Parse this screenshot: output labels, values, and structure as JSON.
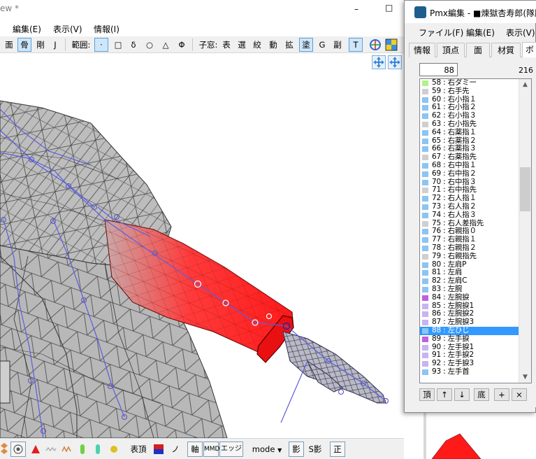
{
  "main_window": {
    "title": "ew *",
    "controls": {
      "minimize": "–",
      "maximize": "□",
      "close": "✕"
    },
    "menu": [
      "編集(E)",
      "表示(V)",
      "情報(I)"
    ],
    "toolbar": {
      "mode_buttons": [
        "面",
        "骨",
        "剛",
        "J"
      ],
      "range_label": "範囲:",
      "range_buttons": [
        "·",
        "□",
        "δ",
        "○",
        "△",
        "Φ"
      ],
      "child_label": "子窓:",
      "child_buttons": [
        "表",
        "選",
        "絞",
        "動",
        "拡",
        "塗",
        "G",
        "副",
        "T"
      ]
    }
  },
  "bottom_toolbar": {
    "vertex_label": "表頂",
    "mirror_label": "ノミ",
    "axis_button": "軸",
    "mmd_button": "MMD",
    "edge_button": "エッジ",
    "mode_select": "mode",
    "shadow_button": "影",
    "sshadow_button": "S影",
    "ortho_button": "正"
  },
  "pmx_window": {
    "title": "Pmx編集 - ■煉獄杏寿郎(隊服",
    "menu": [
      "ファイル(F)",
      "編集(E)",
      "表示(V)"
    ],
    "tabs": [
      "情報",
      "頂点",
      "面",
      "材質",
      "ボ"
    ],
    "bone_index": "88",
    "bone_count": "216",
    "bones": [
      {
        "label": "58 : 右ダミー",
        "color": "#b4f08c"
      },
      {
        "label": "59 : 右手先",
        "color": "#cfcfcf"
      },
      {
        "label": "60 : 右小指１",
        "color": "#8cc4f2"
      },
      {
        "label": "61 : 右小指２",
        "color": "#8cc4f2"
      },
      {
        "label": "62 : 右小指３",
        "color": "#8cc4f2"
      },
      {
        "label": "63 : 右小指先",
        "color": "#cfcfcf"
      },
      {
        "label": "64 : 右薬指１",
        "color": "#8cc4f2"
      },
      {
        "label": "65 : 右薬指２",
        "color": "#8cc4f2"
      },
      {
        "label": "66 : 右薬指３",
        "color": "#8cc4f2"
      },
      {
        "label": "67 : 右薬指先",
        "color": "#cfcfcf"
      },
      {
        "label": "68 : 右中指１",
        "color": "#8cc4f2"
      },
      {
        "label": "69 : 右中指２",
        "color": "#8cc4f2"
      },
      {
        "label": "70 : 右中指３",
        "color": "#8cc4f2"
      },
      {
        "label": "71 : 右中指先",
        "color": "#cfcfcf"
      },
      {
        "label": "72 : 右人指１",
        "color": "#8cc4f2"
      },
      {
        "label": "73 : 右人指２",
        "color": "#8cc4f2"
      },
      {
        "label": "74 : 右人指３",
        "color": "#8cc4f2"
      },
      {
        "label": "75 : 右人差指先",
        "color": "#cfcfcf"
      },
      {
        "label": "76 : 右親指０",
        "color": "#8cc4f2"
      },
      {
        "label": "77 : 右親指１",
        "color": "#8cc4f2"
      },
      {
        "label": "78 : 右親指２",
        "color": "#8cc4f2"
      },
      {
        "label": "79 : 右親指先",
        "color": "#cfcfcf"
      },
      {
        "label": "80 : 左肩P",
        "color": "#8cc4f2"
      },
      {
        "label": "81 : 左肩",
        "color": "#8cc4f2"
      },
      {
        "label": "82 : 左肩C",
        "color": "#8cc4f2"
      },
      {
        "label": "83 : 左腕",
        "color": "#8cc4f2"
      },
      {
        "label": "84 : 左腕捩",
        "color": "#c060e0"
      },
      {
        "label": "85 : 左腕捩1",
        "color": "#c8b4f0"
      },
      {
        "label": "86 : 左腕捩2",
        "color": "#c8b4f0"
      },
      {
        "label": "87 : 左腕捩3",
        "color": "#c8b4f0"
      },
      {
        "label": "88 : 左ひじ",
        "color": "#8cc4f2",
        "selected": true
      },
      {
        "label": "89 : 左手捩",
        "color": "#c060e0"
      },
      {
        "label": "90 : 左手捩1",
        "color": "#c8b4f0"
      },
      {
        "label": "91 : 左手捩2",
        "color": "#c8b4f0"
      },
      {
        "label": "92 : 左手捩3",
        "color": "#c8b4f0"
      },
      {
        "label": "93 : 左手首",
        "color": "#8cc4f2"
      }
    ],
    "buttons": [
      "頂",
      "↑",
      "↓",
      "底",
      "+",
      "×"
    ]
  },
  "colors": {
    "selected_mesh": "#ff1a1a",
    "mesh_fill": "#bcbcbc",
    "bone_line": "#5d5de0",
    "selection_bg": "#3399ff"
  }
}
